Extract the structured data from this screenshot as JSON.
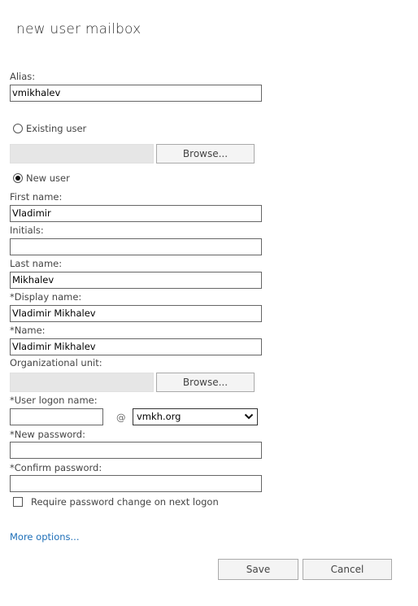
{
  "dialog": {
    "title": "new user mailbox"
  },
  "form": {
    "alias": {
      "label": "Alias:",
      "value": "vmikhalev"
    },
    "existing_user": {
      "label": "Existing user",
      "selected": false,
      "value": "",
      "browse_label": "Browse..."
    },
    "new_user": {
      "label": "New user",
      "selected": true
    },
    "first_name": {
      "label": "First name:",
      "value": "Vladimir"
    },
    "initials": {
      "label": "Initials:",
      "value": ""
    },
    "last_name": {
      "label": "Last name:",
      "value": "Mikhalev"
    },
    "display_name": {
      "label": "*Display name:",
      "value": "Vladimir Mikhalev"
    },
    "name": {
      "label": "*Name:",
      "value": "Vladimir Mikhalev"
    },
    "organizational_unit": {
      "label": "Organizational unit:",
      "value": "",
      "browse_label": "Browse..."
    },
    "user_logon_name": {
      "label": "*User logon name:",
      "value": "",
      "at_symbol": "@",
      "domain_selected": "vmkh.org"
    },
    "new_password": {
      "label": "*New password:",
      "value": ""
    },
    "confirm_password": {
      "label": "*Confirm password:",
      "value": ""
    },
    "require_password_change": {
      "label": "Require password change on next logon",
      "checked": false
    }
  },
  "links": {
    "more_options": "More options..."
  },
  "buttons": {
    "save": "Save",
    "cancel": "Cancel"
  }
}
